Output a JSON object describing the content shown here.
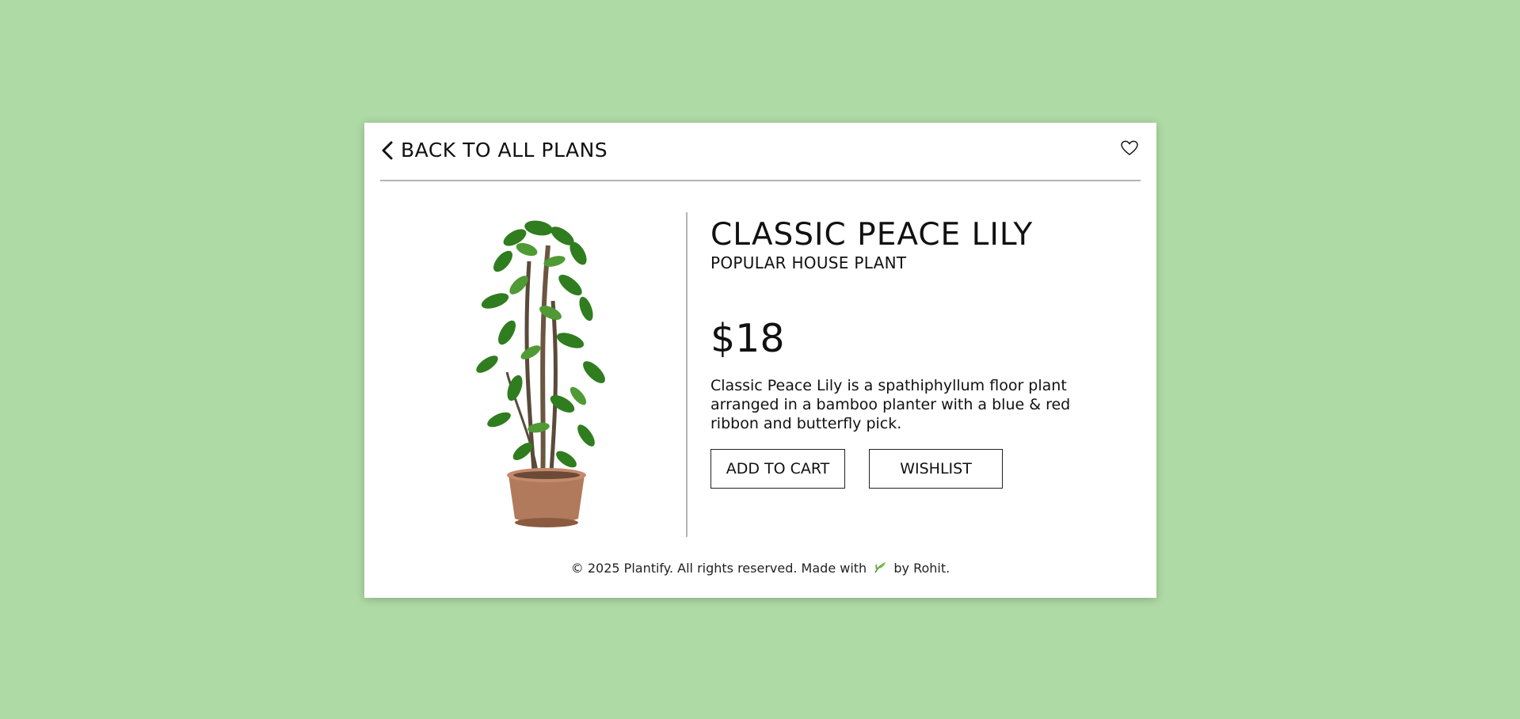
{
  "header": {
    "back_label": "BACK TO ALL PLANS"
  },
  "product": {
    "title": "CLASSIC PEACE LILY",
    "subtitle": "POPULAR HOUSE PLANT",
    "price": "$18",
    "description": "Classic Peace Lily is a spathiphyllum floor plant arranged in a bamboo planter with a blue & red ribbon and butterfly pick."
  },
  "actions": {
    "add_to_cart_label": "ADD TO CART",
    "wishlist_label": "WISHLIST"
  },
  "footer": {
    "text_before": "© 2025 Plantify. All rights reserved. Made with",
    "text_after": "by Rohit."
  },
  "icons": {
    "back": "chevron-left-icon",
    "favorite": "heart-icon",
    "footer_emoji": "leaf-icon"
  },
  "colors": {
    "background": "#aedaa5",
    "card": "#ffffff",
    "divider": "#b3b3b3",
    "text": "#111111"
  }
}
